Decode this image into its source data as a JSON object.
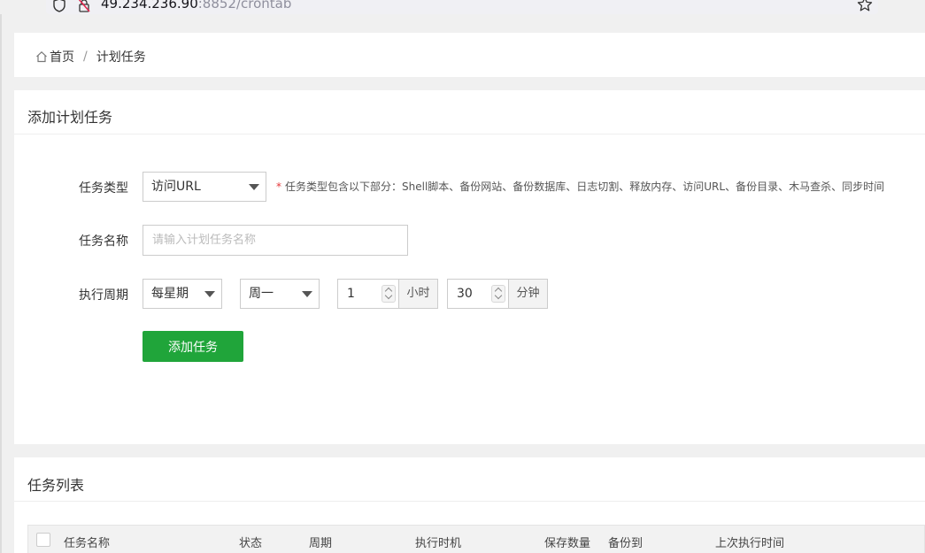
{
  "browser": {
    "url_main": "49.234.236.90",
    "url_dim": ":8852/crontab"
  },
  "breadcrumb": {
    "home": "首页",
    "separator": "/",
    "current": "计划任务"
  },
  "add_form": {
    "title": "添加计划任务",
    "task_type": {
      "label": "任务类型",
      "selected": "访问URL",
      "hint_required_mark": "*",
      "hint": "任务类型包含以下部分：Shell脚本、备份网站、备份数据库、日志切割、释放内存、访问URL、备份目录、木马查杀、同步时间"
    },
    "task_name": {
      "label": "任务名称",
      "value": "",
      "placeholder": "请输入计划任务名称"
    },
    "cycle": {
      "label": "执行周期",
      "period_selected": "每星期",
      "weekday_selected": "周一",
      "hour_value": "1",
      "hour_unit": "小时",
      "minute_value": "30",
      "minute_unit": "分钟"
    },
    "submit_label": "添加任务"
  },
  "task_list": {
    "title": "任务列表",
    "columns": [
      "任务名称",
      "状态",
      "周期",
      "执行时机",
      "保存数量",
      "备份到",
      "上次执行时间"
    ]
  },
  "colors": {
    "primary_green": "#20a53a",
    "required_red": "#e4393c"
  }
}
